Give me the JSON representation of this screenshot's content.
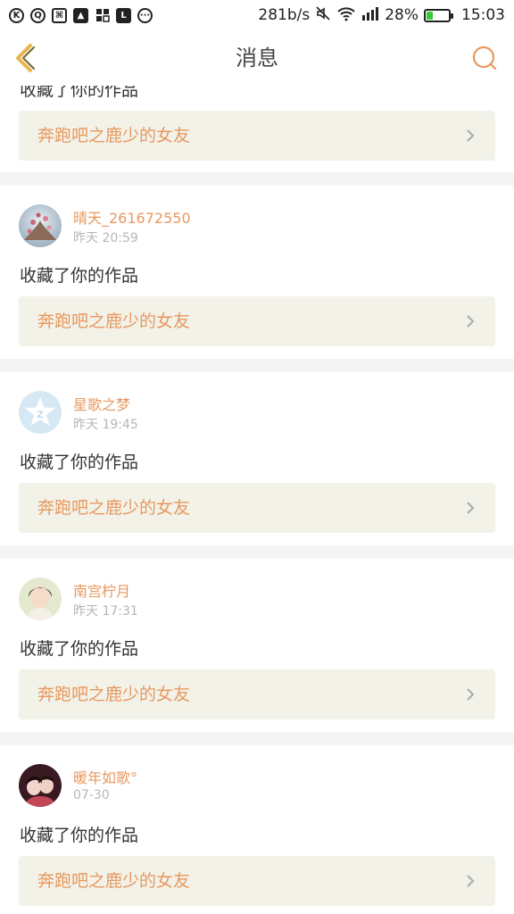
{
  "status_bar": {
    "left_icons": [
      "k-circle-icon",
      "q-bubble-icon",
      "app-icon",
      "image-icon",
      "grid-app-icon",
      "book-app-icon",
      "chat-more-icon"
    ],
    "speed": "281b/s",
    "right_icons": [
      "mute-icon",
      "wifi-icon",
      "signal-icon"
    ],
    "battery_percent_text": "28%",
    "battery_level": 0.28,
    "time": "15:03"
  },
  "nav": {
    "title": "消息",
    "back_icon": "chevron-left-icon",
    "search_icon": "search-icon"
  },
  "colors": {
    "accent": "#e8985f",
    "link_bg": "#f2f2e8",
    "back_icon": "#e9b44c"
  },
  "partial_item": {
    "text": "收藏了你的作品",
    "work_title": "奔跑吧之鹿少的女友"
  },
  "messages": [
    {
      "user": "晴天_261672550",
      "time": "昨天 20:59",
      "text": "收藏了你的作品",
      "work_title": "奔跑吧之鹿少的女友",
      "avatar": "flower-avatar"
    },
    {
      "user": "星歌之梦",
      "time": "昨天 19:45",
      "text": "收藏了你的作品",
      "work_title": "奔跑吧之鹿少的女友",
      "avatar": "default-star-avatar"
    },
    {
      "user": "南宫柠月",
      "time": "昨天 17:31",
      "text": "收藏了你的作品",
      "work_title": "奔跑吧之鹿少的女友",
      "avatar": "girl-avatar"
    },
    {
      "user": "暖年如歌°",
      "time": "07-30",
      "text": "收藏了你的作品",
      "work_title": "奔跑吧之鹿少的女友",
      "avatar": "couple-avatar"
    }
  ]
}
